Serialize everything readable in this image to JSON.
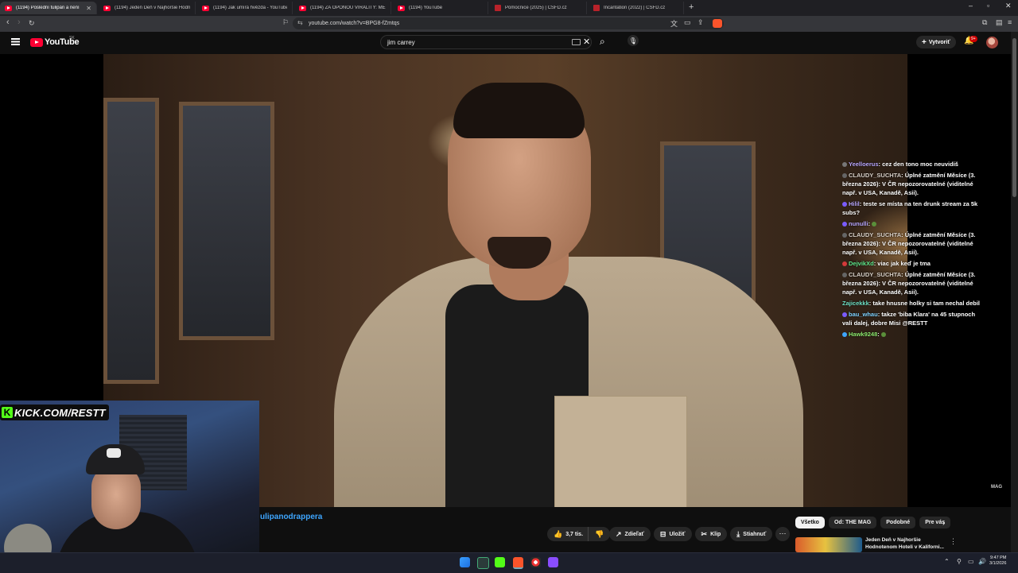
{
  "browser": {
    "tabs": [
      {
        "label": "(1194) Poslední tulipán a není",
        "icon": "youtube-icon",
        "active": true
      },
      {
        "label": "(1194) Jeden Deň v Najhoršie Hodno",
        "icon": "youtube-icon",
        "active": false
      },
      {
        "label": "(1194) Jak umírá hvězda - YouTube",
        "icon": "youtube-icon",
        "active": false
      },
      {
        "label": "(1194) ZA OPONOU VIRALITY: MEL",
        "icon": "youtube-icon",
        "active": false
      },
      {
        "label": "(1194) YouTube",
        "icon": "youtube-icon",
        "active": false
      },
      {
        "label": "Pomocnice (2025) | ČSFD.cz",
        "icon": "csfd-icon",
        "active": false
      },
      {
        "label": "Incantation (2022) | ČSFD.cz",
        "icon": "csfd-icon",
        "active": false
      }
    ],
    "url": "youtube.com/watch?v=BPG8-fZmtqs"
  },
  "youtube": {
    "logo_text": "YouTube",
    "country_code": "SK",
    "search_value": "jim carrey",
    "create_label": "Vytvoriť",
    "notification_badge": "9+"
  },
  "stream": {
    "kick_label": "KICK.COM/RESTT",
    "video_watermark": "MAG"
  },
  "chat": [
    {
      "user": "Yeelloerus",
      "text": "cez den tono moc neuvidiš",
      "user_color": "#b8a7ff",
      "badge": "#777777"
    },
    {
      "user": "CLAUDY_SUCHTA",
      "text": "Úplné zatmění Měsíce (3. března 2026): V ČR nepozorovatelné (viditelné např. v USA, Kanadě, Asii).",
      "user_color": "#d8d0c8",
      "badge": "#666666"
    },
    {
      "user": "Hilil",
      "text": "teste se místa na ten drunk stream za 5k subs?",
      "user_color": "#b8a7ff",
      "badge": "#7a5cff"
    },
    {
      "user": "nunulli",
      "text": "",
      "user_color": "#b8a7ff",
      "badge": "#7a5cff"
    },
    {
      "user": "CLAUDY_SUCHTA",
      "text": "Úplné zatmění Měsíce (3. března 2026): V ČR nepozorovatelné (viditelné např. v USA, Kanadě, Asii).",
      "user_color": "#d8d0c8",
      "badge": "#666666"
    },
    {
      "user": "DejvikXd",
      "text": "viac jak keď je tma",
      "user_color": "#5de88c",
      "badge": "#d23a3a"
    },
    {
      "user": "CLAUDY_SUCHTA",
      "text": "Úplné zatmění Měsíce (3. března 2026): V ČR nepozorovatelné (viditelné např. v USA, Kanadě, Asii).",
      "user_color": "#d8d0c8",
      "badge": "#666666"
    },
    {
      "user": "Zajicekkk",
      "text": "take hnusne holky si tam nechal debil",
      "user_color": "#6de0c5",
      "badge": ""
    },
    {
      "user": "bau_whau",
      "text": "takze 'biba Klara' na 45 stupnoch vali dalej, dobre Misi @RESTT",
      "user_color": "#7fd2ff",
      "badge": "#7a5cff"
    },
    {
      "user": "Hawk9248",
      "text": "",
      "user_color": "#8be86d",
      "badge": "#3ea6ff"
    }
  ],
  "video": {
    "channel_title": "ulipanodrappera",
    "likes_label": "3,7 tis.",
    "share_label": "Zdieľať",
    "save_label": "Uložiť",
    "clip_label": "Klip",
    "download_label": "Stiahnuť"
  },
  "chips": [
    "Všetko",
    "Od: THE MAG",
    "Podobné",
    "Pre vás"
  ],
  "recommendation": {
    "title": "Jeden Deň v Najhoršie Hodnotenom Hoteli v Kaliforni..."
  },
  "taskbar": {
    "time": "9:47 PM",
    "date": "3/1/2026"
  },
  "colors": {
    "accent_red": "#ff0033",
    "link_blue": "#3ea6ff",
    "kick_green": "#53fc18",
    "bg": "#0f0f0f"
  }
}
